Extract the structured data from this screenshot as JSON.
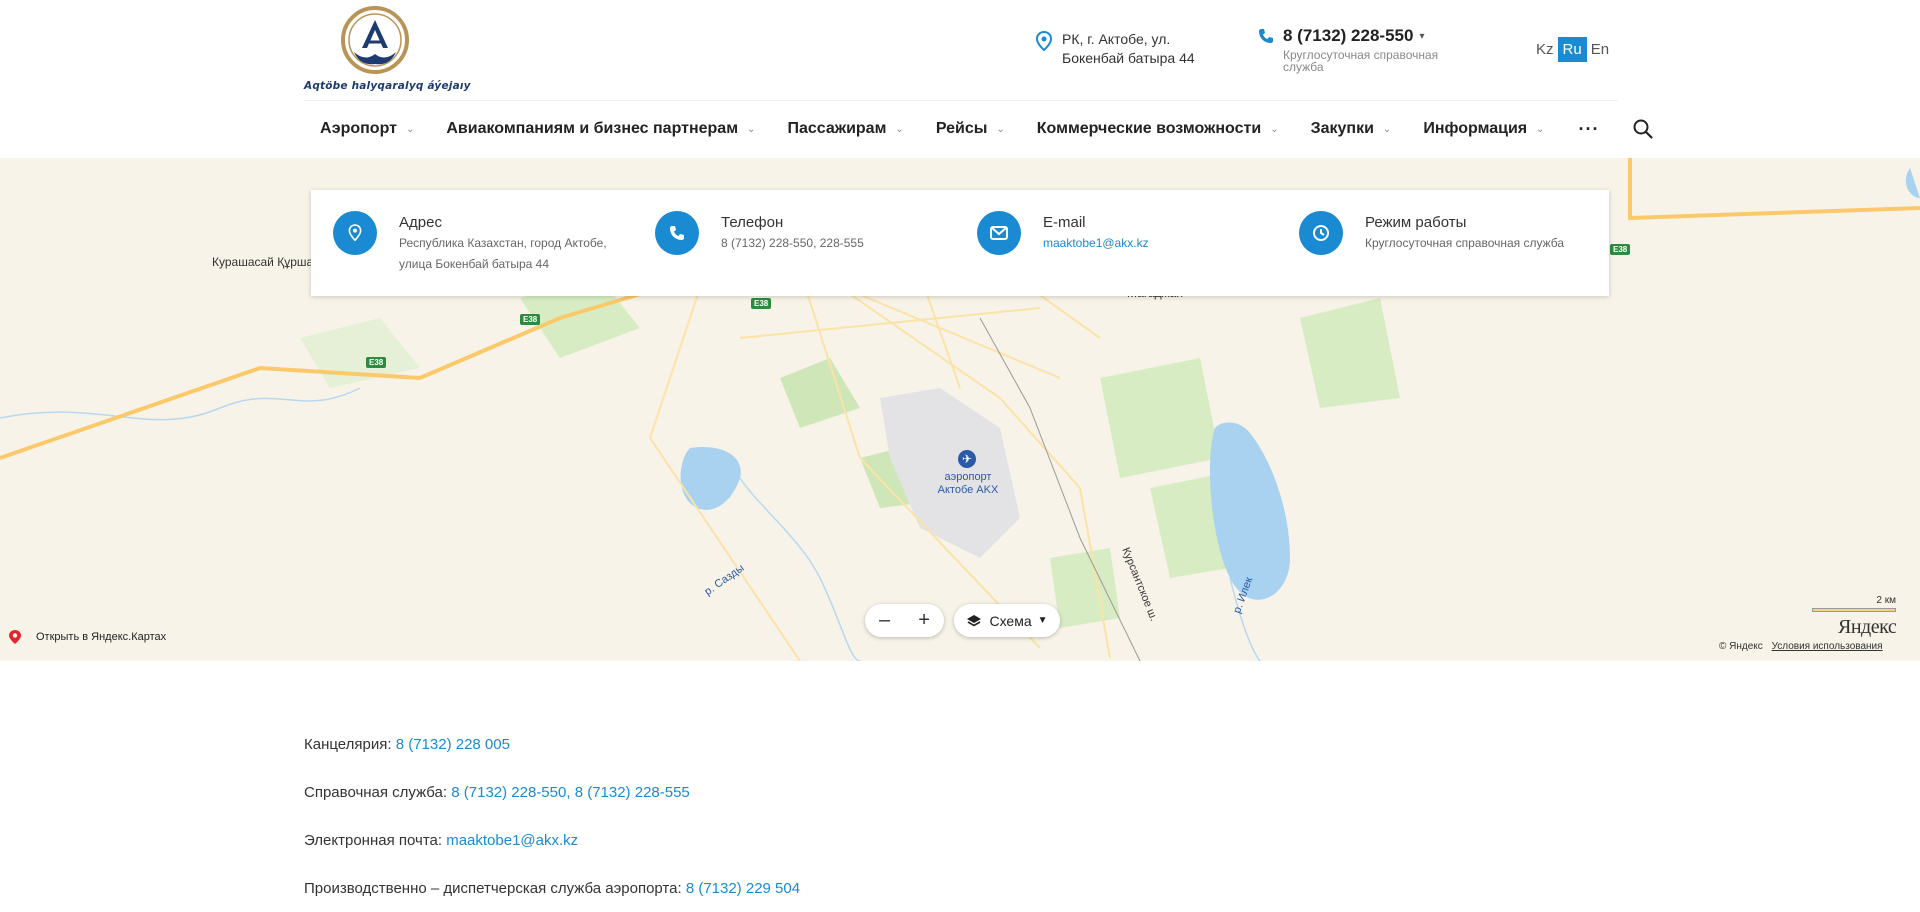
{
  "header": {
    "logo_text": "Aqtöbe halyqaralyq áýejaıy",
    "address": "РК, г. Актобе, ул. Бокенбай батыра 44",
    "phone": "8 (7132) 228-550",
    "phone_sub": "Круглосуточная справочная служба",
    "languages": [
      "Kz",
      "Ru",
      "En"
    ],
    "active_language": "Ru"
  },
  "nav": {
    "items": [
      "Аэропорт",
      "Авиакомпаниям и бизнес партнерам",
      "Пассажирам",
      "Рейсы",
      "Коммерческие возможности",
      "Закупки",
      "Информация"
    ],
    "more": "···"
  },
  "info": {
    "address_title": "Адрес",
    "address_text": "Республика Казахстан, город Актобе, улица Бокенбай батыра 44",
    "phone_title": "Телефон",
    "phone_text": "8 (7132) 228-550, 228-555",
    "email_title": "E-mail",
    "email_text": "maaktobe1@akx.kz",
    "hours_title": "Режим работы",
    "hours_text": "Круглосуточная справочная служба"
  },
  "map": {
    "labels": {
      "kurashasay": "Курашасай Құршасай",
      "magadzhan": "Магаджан Магаджан",
      "airport": "аэропорт Актобе AKX",
      "lake_sazdy": "р. Сазды",
      "lake_ilek": "р. Илек",
      "kursant_road": "Курсантское ш."
    },
    "highways": [
      "E38",
      "E38",
      "E38",
      "E38"
    ],
    "scheme_label": "Схема",
    "zoom_out": "–",
    "zoom_in": "+",
    "open_in_yandex": "Открыть в Яндекс.Картах",
    "scale": "2 км",
    "yandex_logo": "Яндекс",
    "copyright": "© Яндекс",
    "terms": "Условия использования"
  },
  "contacts": {
    "office_label": "Канцелярия:",
    "office_phone": "8 (7132) 228 005",
    "help_label": "Справочная служба:",
    "help_phone_1": "8 (7132) 228-550",
    "help_sep": ",",
    "help_phone_2": "8 (7132) 228-555",
    "email_label": "Электронная почта:",
    "email": "maaktobe1@akx.kz",
    "dispatch_label": "Производственно – диспетчерская служба аэропорта:",
    "dispatch_phone": "8 (7132) 229 504"
  },
  "colors": {
    "accent": "#1a8ad3",
    "logo_blue": "#1d3a72",
    "logo_gold": "#b89456"
  }
}
